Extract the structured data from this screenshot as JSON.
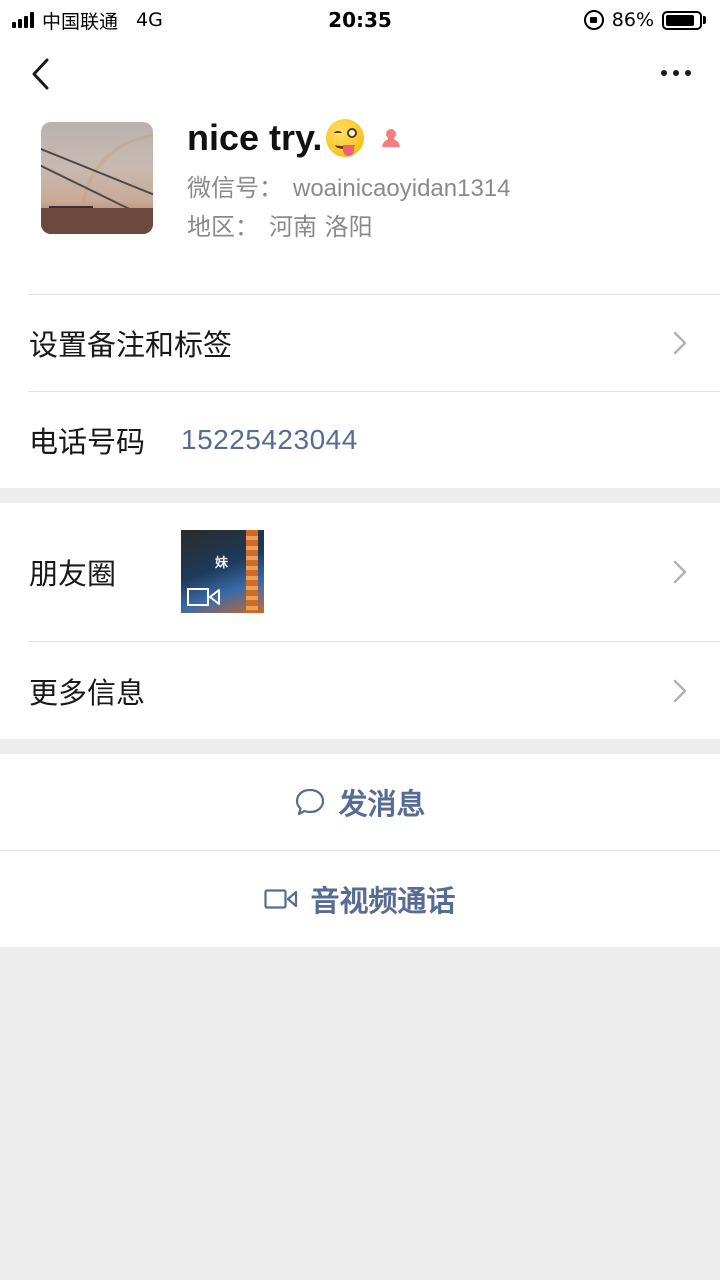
{
  "status_bar": {
    "carrier": "中国联通",
    "network": "4G",
    "time": "20:35",
    "battery_percent": "86%",
    "battery_level": 0.86
  },
  "profile": {
    "name": "nice try.",
    "wechat_id_label": "微信号：",
    "wechat_id": "woainicaoyidan1314",
    "region_label": "地区：",
    "region": "河南 洛阳",
    "gender_icon": "female-icon",
    "gender_color": "#f37e7d"
  },
  "rows": {
    "remark_label": "设置备注和标签",
    "phone_label": "电话号码",
    "phone_value": "15225423044",
    "moments_label": "朋友圈",
    "moments_thumb_text": "妹",
    "more_info_label": "更多信息"
  },
  "actions": {
    "message_label": "发消息",
    "call_label": "音视频通话"
  },
  "colors": {
    "link": "#576b95",
    "background": "#ededed",
    "text": "#191919",
    "secondary": "#8a8a8a"
  }
}
